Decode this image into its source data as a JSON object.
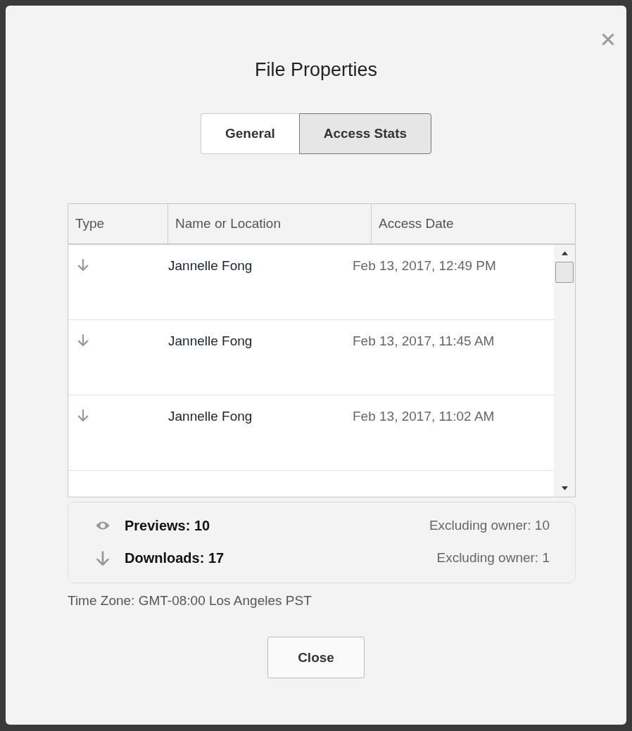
{
  "dialog": {
    "title": "File Properties"
  },
  "tabs": [
    {
      "label": "General",
      "selected": false
    },
    {
      "label": "Access Stats",
      "selected": true
    }
  ],
  "table": {
    "columns": [
      "Type",
      "Name or Location",
      "Access Date"
    ],
    "rows": [
      {
        "kind": "download",
        "name": "Jannelle Fong",
        "date": "Feb 13, 2017, 12:49 PM"
      },
      {
        "kind": "download",
        "name": "Jannelle Fong",
        "date": "Feb 13, 2017, 11:45 AM"
      },
      {
        "kind": "download",
        "name": "Jannelle Fong",
        "date": "Feb 13, 2017, 11:02 AM"
      }
    ]
  },
  "summary": [
    {
      "kind": "preview",
      "label": "Previews: 10",
      "excluding": "Excluding owner: 10"
    },
    {
      "kind": "download",
      "label": "Downloads: 17",
      "excluding": "Excluding owner: 1"
    }
  ],
  "time_zone": "Time Zone: GMT-08:00 Los Angeles PST",
  "buttons": [
    "Close"
  ]
}
